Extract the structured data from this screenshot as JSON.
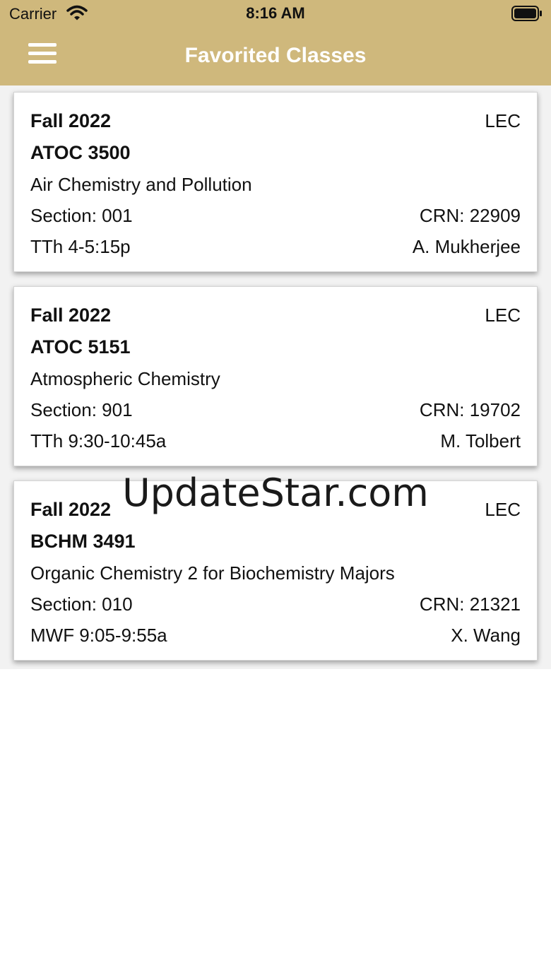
{
  "status_bar": {
    "carrier": "Carrier",
    "time": "8:16 AM"
  },
  "nav": {
    "title": "Favorited Classes"
  },
  "classes": [
    {
      "term": "Fall 2022",
      "type": "LEC",
      "code": "ATOC 3500",
      "name": "Air Chemistry and Pollution",
      "section": "Section: 001",
      "crn": "CRN: 22909",
      "schedule": "TTh 4-5:15p",
      "instructor": "A. Mukherjee"
    },
    {
      "term": "Fall 2022",
      "type": "LEC",
      "code": "ATOC 5151",
      "name": "Atmospheric Chemistry",
      "section": "Section: 901",
      "crn": "CRN: 19702",
      "schedule": "TTh 9:30-10:45a",
      "instructor": "M. Tolbert"
    },
    {
      "term": "Fall 2022",
      "type": "LEC",
      "code": "BCHM 3491",
      "name": "Organic Chemistry 2 for Biochemistry Majors",
      "section": "Section: 010",
      "crn": "CRN: 21321",
      "schedule": "MWF 9:05-9:55a",
      "instructor": "X. Wang"
    }
  ],
  "watermark": "UpdateStar.com",
  "colors": {
    "header": "#cfb87c",
    "list_background": "#f2f2f2",
    "card": "#ffffff"
  },
  "icons": {
    "wifi": "wifi-icon",
    "battery": "battery-icon",
    "menu": "hamburger-menu-icon"
  }
}
